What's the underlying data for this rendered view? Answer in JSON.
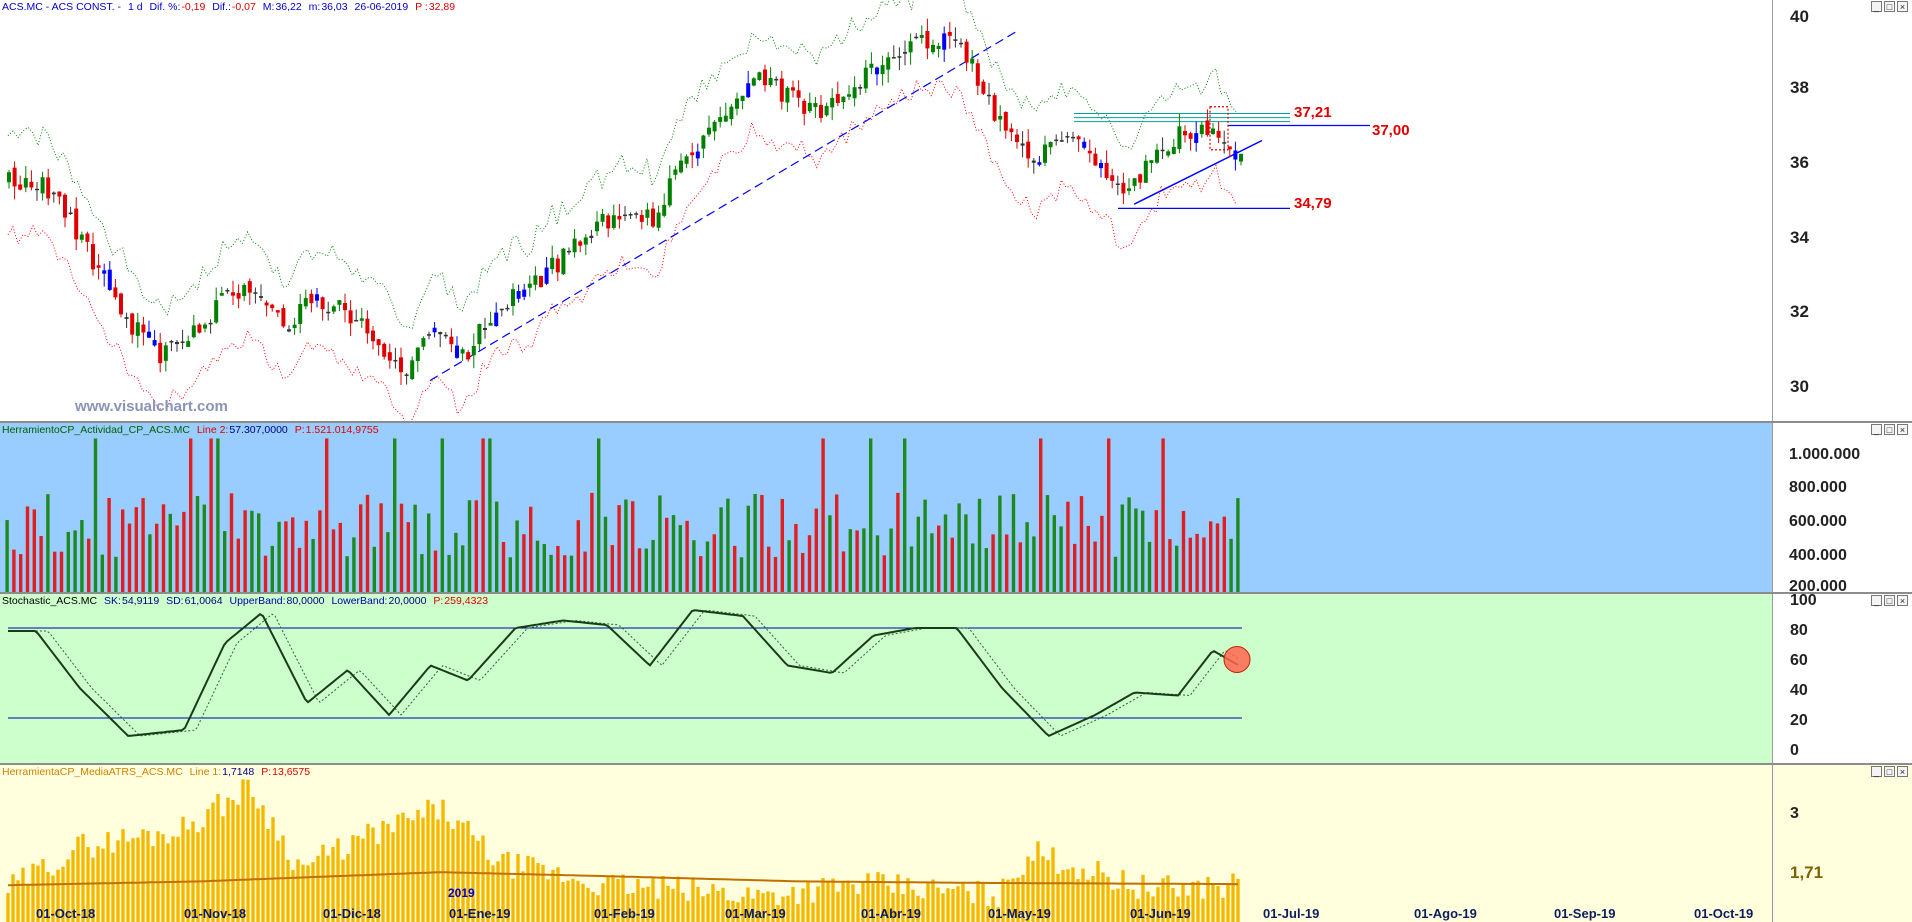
{
  "panel1": {
    "header": {
      "symbol": "ACS.MC - ACS CONST. -",
      "period": "1 d",
      "dif_pct_label": "Dif. %:",
      "dif_pct_value": "-0,19",
      "dif_label": "Dif.:",
      "dif_value": "-0,07",
      "max_label": "M:",
      "max_value": "36,22",
      "min_label": "m:",
      "min_value": "36,03",
      "date": "26-06-2019",
      "p_label": "P :",
      "p_value": "32,89"
    },
    "watermark": "www.visualchart.com",
    "year_marker": "2019",
    "level_labels": [
      "37,21",
      "37,00",
      "34,79"
    ],
    "y_ticks": [
      "40",
      "38",
      "36",
      "34",
      "32",
      "30"
    ]
  },
  "panel2": {
    "header": {
      "name": "HerramientoCP_Actividad_CP_ACS.MC",
      "line_label": "Line 2:",
      "line_value": "57.307,0000",
      "p_label": "P:",
      "p_value": "1.521.014,9755"
    },
    "y_ticks": [
      "1.000.000",
      "800.000",
      "600.000",
      "400.000",
      "200.000"
    ]
  },
  "panel3": {
    "header": {
      "name": "Stochastic_ACS.MC",
      "sk_label": "SK:",
      "sk_value": "54,9119",
      "sd_label": "SD:",
      "sd_value": "61,0064",
      "ub_label": "UpperBand:",
      "ub_value": "80,0000",
      "lb_label": "LowerBand:",
      "lb_value": "20,0000",
      "p_label": "P:",
      "p_value": "259,4323"
    },
    "y_ticks": [
      "100",
      "80",
      "60",
      "40",
      "20",
      "0"
    ]
  },
  "panel4": {
    "header": {
      "name": "HerramientaCP_MediaATRS_ACS.MC",
      "line_label": "Line 1:",
      "line_value": "1,7148",
      "p_label": "P:",
      "p_value": "13,6575"
    },
    "y_ticks": [
      "3",
      "1,71"
    ]
  },
  "x_axis": [
    "01-Oct-18",
    "01-Nov-18",
    "01-Dic-18",
    "01-Ene-19",
    "01-Feb-19",
    "01-Mar-19",
    "01-Abr-19",
    "01-May-19",
    "01-Jun-19",
    "01-Jul-19",
    "01-Ago-19",
    "01-Sep-19",
    "01-Oct-19"
  ],
  "colors": {
    "up": "#008000",
    "down": "#e00000",
    "doji": "#0000ff",
    "vol_up": "#1e8a1e",
    "vol_down": "#e02020",
    "atr_bar": "#f5b800",
    "atr_avg": "#c07000",
    "band_upper": "#008000",
    "band_lower": "#ff0000",
    "trend": "#0000ff"
  },
  "chart_data": [
    {
      "type": "candlestick",
      "title": "ACS.MC - ACS CONST.",
      "x_labels": [
        "01-Oct-18",
        "01-Nov-18",
        "01-Dic-18",
        "01-Ene-19",
        "01-Feb-19",
        "01-Mar-19",
        "01-Abr-19",
        "01-May-19",
        "01-Jun-19"
      ],
      "ylim": [
        29.1,
        40.2
      ],
      "close_path": [
        [
          "01-Oct-18",
          35.5
        ],
        [
          "05-Oct-18",
          35.1
        ],
        [
          "12-Oct-18",
          33.6
        ],
        [
          "19-Oct-18",
          32.0
        ],
        [
          "26-Oct-18",
          30.8
        ],
        [
          "01-Nov-18",
          31.2
        ],
        [
          "09-Nov-18",
          32.3
        ],
        [
          "16-Nov-18",
          32.7
        ],
        [
          "23-Nov-18",
          31.6
        ],
        [
          "30-Nov-18",
          32.4
        ],
        [
          "07-Dic-18",
          32.0
        ],
        [
          "14-Dic-18",
          31.4
        ],
        [
          "21-Dic-18",
          30.2
        ],
        [
          "28-Dic-18",
          31.8
        ],
        [
          "04-Ene-19",
          30.8
        ],
        [
          "11-Ene-19",
          32.2
        ],
        [
          "18-Ene-19",
          32.6
        ],
        [
          "25-Ene-19",
          33.5
        ],
        [
          "01-Feb-19",
          34.2
        ],
        [
          "08-Feb-19",
          34.8
        ],
        [
          "15-Feb-19",
          34.4
        ],
        [
          "22-Feb-19",
          36.2
        ],
        [
          "01-Mar-19",
          37.3
        ],
        [
          "08-Mar-19",
          38.2
        ],
        [
          "15-Mar-19",
          37.8
        ],
        [
          "22-Mar-19",
          37.4
        ],
        [
          "29-Mar-19",
          38.1
        ],
        [
          "05-Abr-19",
          38.6
        ],
        [
          "12-Abr-19",
          39.1
        ],
        [
          "19-Abr-19",
          39.3
        ],
        [
          "26-Abr-19",
          39.0
        ],
        [
          "03-May-19",
          37.2
        ],
        [
          "10-May-19",
          36.0
        ],
        [
          "17-May-19",
          36.7
        ],
        [
          "24-May-19",
          36.2
        ],
        [
          "31-May-19",
          35.1
        ],
        [
          "07-Jun-19",
          36.4
        ],
        [
          "14-Jun-19",
          36.8
        ],
        [
          "21-Jun-19",
          37.0
        ],
        [
          "26-Jun-19",
          36.1
        ]
      ],
      "levels": [
        37.21,
        37.0,
        34.79
      ],
      "last": {
        "date": "26-06-2019",
        "high": 36.22,
        "low": 36.03
      }
    },
    {
      "type": "bar",
      "title": "HerramientoCP_Actividad_CP_ACS.MC",
      "ylim": [
        200000,
        1150000
      ],
      "y_ticks": [
        1000000,
        800000,
        600000,
        400000,
        200000
      ],
      "line_2": 57307.0
    },
    {
      "type": "line",
      "title": "Stochastic_ACS.MC",
      "ylim": [
        0,
        100
      ],
      "bands": [
        20,
        80
      ],
      "sk_last": 54.9119,
      "sd_last": 61.0064,
      "sk_path": [
        [
          "01-Oct-18",
          78
        ],
        [
          "10-Oct-18",
          40
        ],
        [
          "20-Oct-18",
          8
        ],
        [
          "01-Nov-18",
          12
        ],
        [
          "10-Nov-18",
          70
        ],
        [
          "18-Nov-18",
          90
        ],
        [
          "28-Nov-18",
          30
        ],
        [
          "07-Dic-18",
          52
        ],
        [
          "17-Dic-18",
          22
        ],
        [
          "27-Dic-18",
          55
        ],
        [
          "05-Ene-19",
          45
        ],
        [
          "15-Ene-19",
          80
        ],
        [
          "25-Ene-19",
          85
        ],
        [
          "04-Feb-19",
          82
        ],
        [
          "14-Feb-19",
          55
        ],
        [
          "24-Feb-19",
          92
        ],
        [
          "05-Mar-19",
          88
        ],
        [
          "15-Mar-19",
          55
        ],
        [
          "25-Mar-19",
          50
        ],
        [
          "04-Abr-19",
          75
        ],
        [
          "14-Abr-19",
          80
        ],
        [
          "24-Abr-19",
          80
        ],
        [
          "04-May-19",
          40
        ],
        [
          "14-May-19",
          8
        ],
        [
          "24-May-19",
          22
        ],
        [
          "02-Jun-19",
          37
        ],
        [
          "12-Jun-19",
          35
        ],
        [
          "20-Jun-19",
          65
        ],
        [
          "26-Jun-19",
          55
        ]
      ]
    },
    {
      "type": "bar",
      "title": "HerramientaCP_MediaATRS_ACS.MC",
      "ylim": [
        0.9,
        3.8
      ],
      "line_1": 1.7148
    }
  ]
}
